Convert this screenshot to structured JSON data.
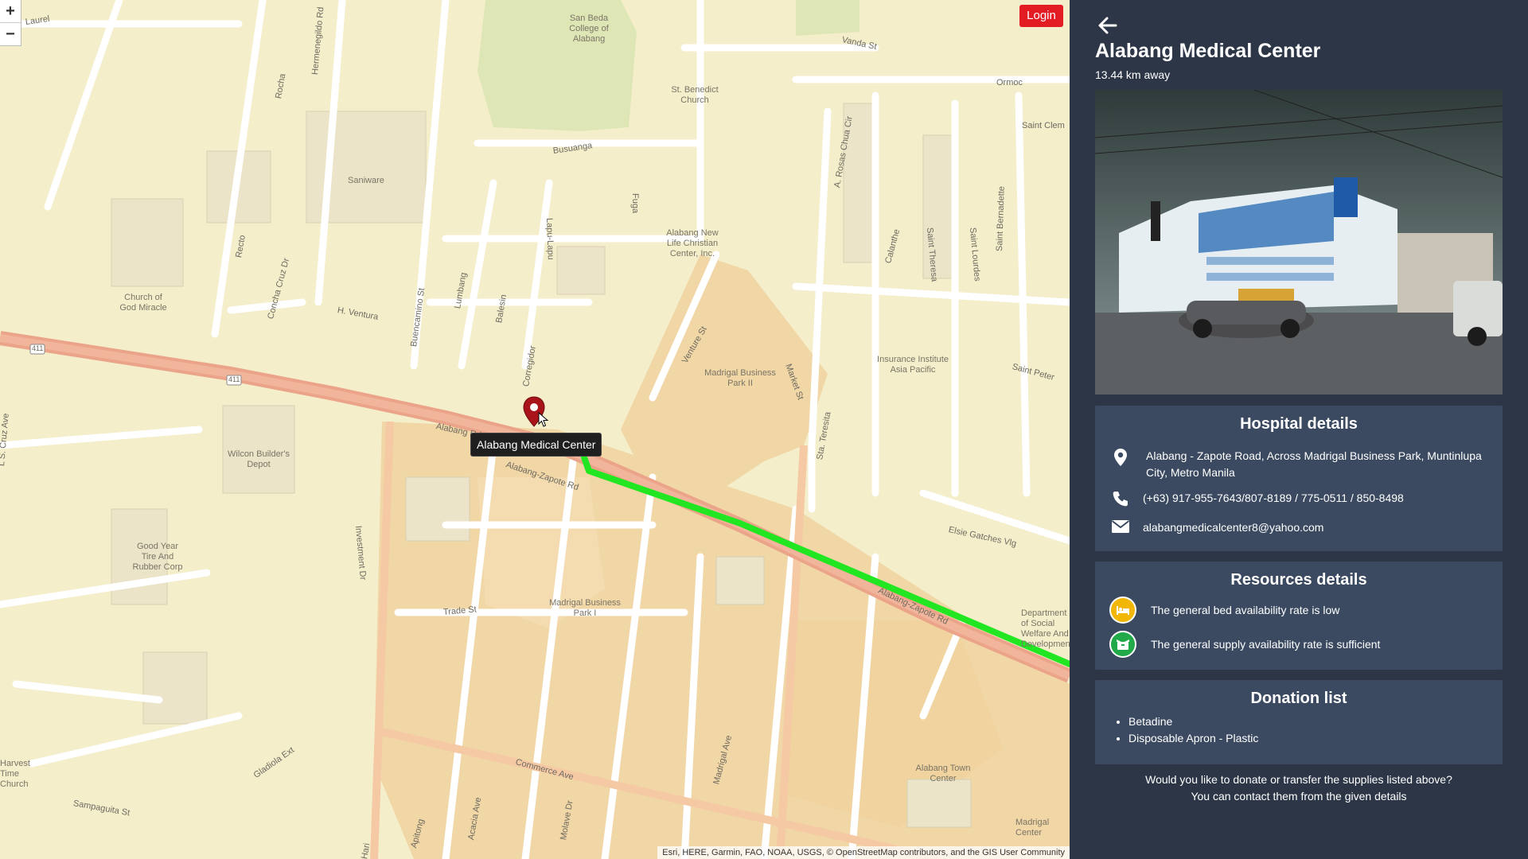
{
  "map": {
    "zoom_in": "+",
    "zoom_out": "−",
    "login_label": "Login",
    "tooltip": "Alabang Medical Center",
    "attribution": "Esri, HERE, Garmin, FAO, NOAA, USGS, © OpenStreetMap contributors, and the GIS User Community",
    "route_color": "#22e622",
    "place_labels": [
      "San Beda College of Alabang",
      "St. Benedict Church",
      "Saniware",
      "Alabang New Life Christian Center, Inc.",
      "Church of God Miracle",
      "Madrigal Business Park II",
      "Insurance Institute Asia Pacific",
      "Wilcon Builder's Depot",
      "Good Year Tire And Rubber Corp",
      "Madrigal Business Park I",
      "Department of Social Welfare And Development",
      "Alabang Town Center",
      "Madrigal Center",
      "Harvest Time Church"
    ],
    "street_labels": [
      "Vanda St",
      "Ormoc",
      "Saint Clem",
      "Busuanga",
      "Fuga",
      "Lapu-Lapu",
      "Recto",
      "Rocha",
      "Hermenegildo Rd",
      "Concha Cruz Dr",
      "H. Ventura",
      "Buencamino St",
      "Lumbang",
      "Balesin",
      "Corregidor",
      "Alabang Rd",
      "Alabang-Zapote Rd",
      "Venture St",
      "Market St",
      "Sta. Teresita",
      "Saint Peter",
      "Saint Theresa",
      "Saint Lourdes",
      "Saint Bernadette",
      "Calanthe",
      "A. Rosas Chua Cir",
      "Elsie Gatches Vlg",
      "Alabang-Zapote Rd",
      "Investment Dr",
      "Trade St",
      "Commerce Ave",
      "Madrigal Ave",
      "Acacia Ave",
      "Molave Dr",
      "Apitong",
      "Hari",
      "Gladiola Ext",
      "Sampaguita St",
      "L S. Cruz Ave",
      "Laurel",
      "411",
      "411"
    ]
  },
  "panel": {
    "title": "Alabang Medical Center",
    "distance": "13.44 km away",
    "hospital": {
      "heading": "Hospital details",
      "address": "Alabang - Zapote Road, Across Madrigal Business Park, Muntinlupa City, Metro Manila",
      "phone": "(+63) 917-955-7643/807-8189 / 775-0511 / 850-8498",
      "email": "alabangmedicalcenter8@yahoo.com"
    },
    "resources": {
      "heading": "Resources details",
      "bed": "The general bed availability rate is low",
      "bed_color": "#f2b705",
      "supply": "The general supply availability rate is sufficient",
      "supply_color": "#22a94a"
    },
    "donations": {
      "heading": "Donation list",
      "items": [
        "Betadine",
        "Disposable Apron - Plastic"
      ]
    },
    "footer_line1": "Would you like to donate or transfer the supplies listed above?",
    "footer_line2": "You can contact them from the given details"
  }
}
